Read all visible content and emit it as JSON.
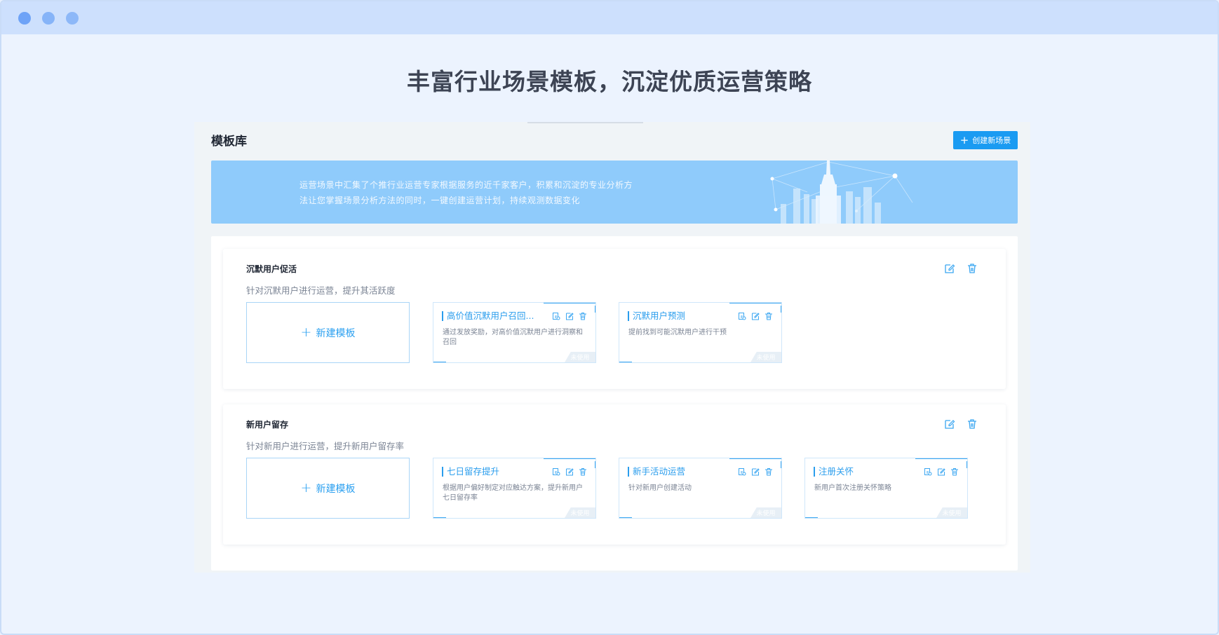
{
  "headline": "丰富行业场景模板，沉淀优质运营策略",
  "library": {
    "title": "模板库",
    "create_button": "创建新场景",
    "banner_line1": "运营场景中汇集了个推行业运营专家根据服务的近千家客户，积累和沉淀的专业分析方",
    "banner_line2": "法让您掌握场景分析方法的同时，一键创建运营计划，持续观测数据变化"
  },
  "new_template_label": "新建模板",
  "scenes": [
    {
      "title": "沉默用户促活",
      "desc": "针对沉默用户进行运营，提升其活跃度",
      "templates": [
        {
          "title": "高价值沉默用户召回...",
          "desc": "通过发放奖励，对高价值沉默用户进行洞察和召回",
          "status": "未使用"
        },
        {
          "title": "沉默用户预测",
          "desc": "提前找到可能沉默用户进行干预",
          "status": "未使用"
        }
      ]
    },
    {
      "title": "新用户留存",
      "desc": "针对新用户进行运营，提升新用户留存率",
      "templates": [
        {
          "title": "七日留存提升",
          "desc": "根据用户偏好制定对应触达方案，提升新用户七日留存率",
          "status": "未使用"
        },
        {
          "title": "新手活动运营",
          "desc": "针对新用户创建活动",
          "status": "未使用"
        },
        {
          "title": "注册关怀",
          "desc": "新用户首次注册关怀策略",
          "status": "未使用"
        }
      ]
    }
  ],
  "colors": {
    "accent": "#1a9bf2",
    "banner": "#8fcbfb",
    "background": "#ecf3fe"
  }
}
